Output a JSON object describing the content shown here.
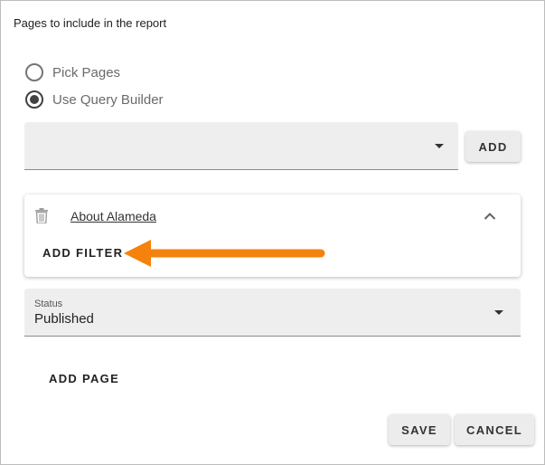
{
  "title": "Pages to include in the report",
  "source_options": [
    {
      "label": "Pick Pages",
      "selected": false
    },
    {
      "label": "Use Query Builder",
      "selected": true
    }
  ],
  "query_select": {
    "value": ""
  },
  "add_label": "ADD",
  "page_card": {
    "page_name": "About Alameda",
    "add_filter_label": "ADD FILTER"
  },
  "status_field": {
    "label": "Status",
    "value": "Published"
  },
  "add_page_label": "ADD PAGE",
  "footer": {
    "save_label": "SAVE",
    "cancel_label": "CANCEL"
  },
  "colors": {
    "arrow": "#f5820d",
    "field_bg": "#eeeeee"
  },
  "icons": {
    "delete": "trash-icon",
    "collapse": "chevron-up-icon",
    "dropdown": "caret-down-icon",
    "annotation": "arrow-left-icon"
  }
}
